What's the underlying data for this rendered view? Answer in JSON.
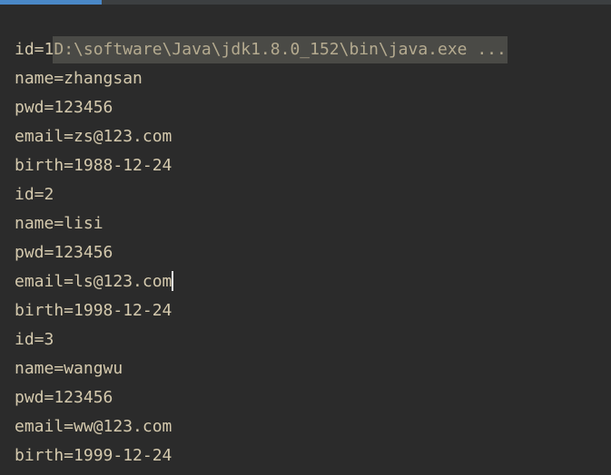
{
  "console": {
    "command": "D:\\software\\Java\\jdk1.8.0_152\\bin\\java.exe ...",
    "lines": [
      "id=1",
      "name=zhangsan",
      "pwd=123456",
      "email=zs@123.com",
      "birth=1988-12-24",
      "id=2",
      "name=lisi",
      "pwd=123456",
      "email=ls@123.com",
      "birth=1998-12-24",
      "id=3",
      "name=wangwu",
      "pwd=123456",
      "email=ww@123.com",
      "birth=1999-12-24"
    ]
  },
  "colors": {
    "background": "#2b2b2b",
    "text": "#d4c9ad",
    "command_highlight": "#4a4a46",
    "active_tab_indicator": "#4a88c7"
  }
}
